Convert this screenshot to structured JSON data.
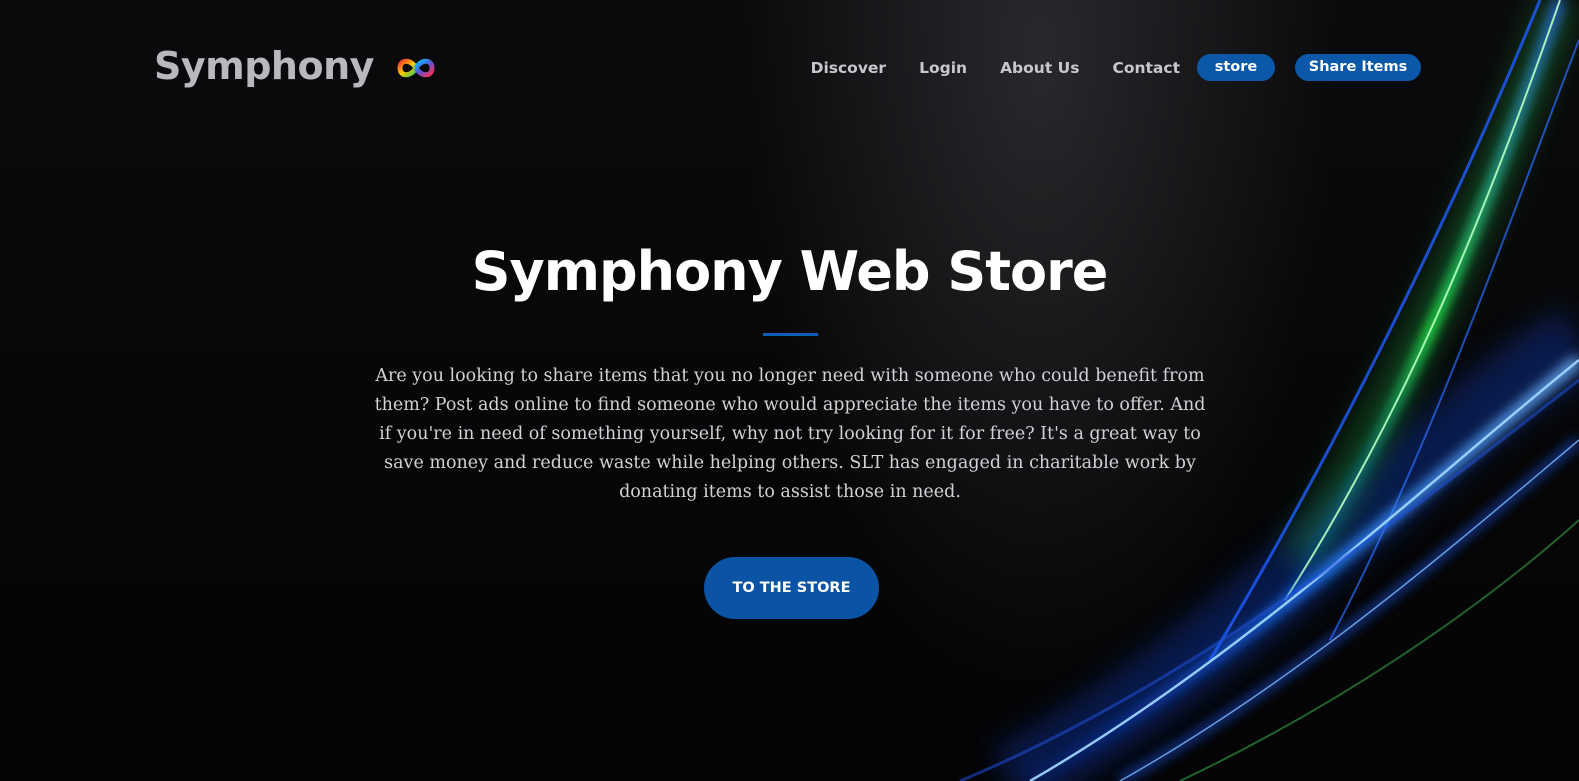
{
  "header": {
    "brand": "Symphony",
    "logo_icon": "rainbow-infinity-icon",
    "nav": [
      {
        "label": "Discover"
      },
      {
        "label": "Login"
      },
      {
        "label": "About Us"
      },
      {
        "label": "Contact"
      }
    ],
    "store_button": "store",
    "share_button": "Share Items"
  },
  "hero": {
    "title": "Symphony Web Store",
    "description": "Are you looking to share items that you no longer need with someone who could benefit from them? Post ads online to find someone who would appreciate the items you have to offer. And if you're in need of something yourself, why not try looking for it for free? It's a great way to save money and reduce waste while helping others. SLT has engaged in charitable work by donating items to assist those in need.",
    "cta_label": "TO THE STORE"
  },
  "colors": {
    "accent": "#0b57a8",
    "background": "#050506",
    "brand_text": "#b9b9bd",
    "ray_blue": "#1e6bff",
    "ray_green": "#22ff4a"
  }
}
